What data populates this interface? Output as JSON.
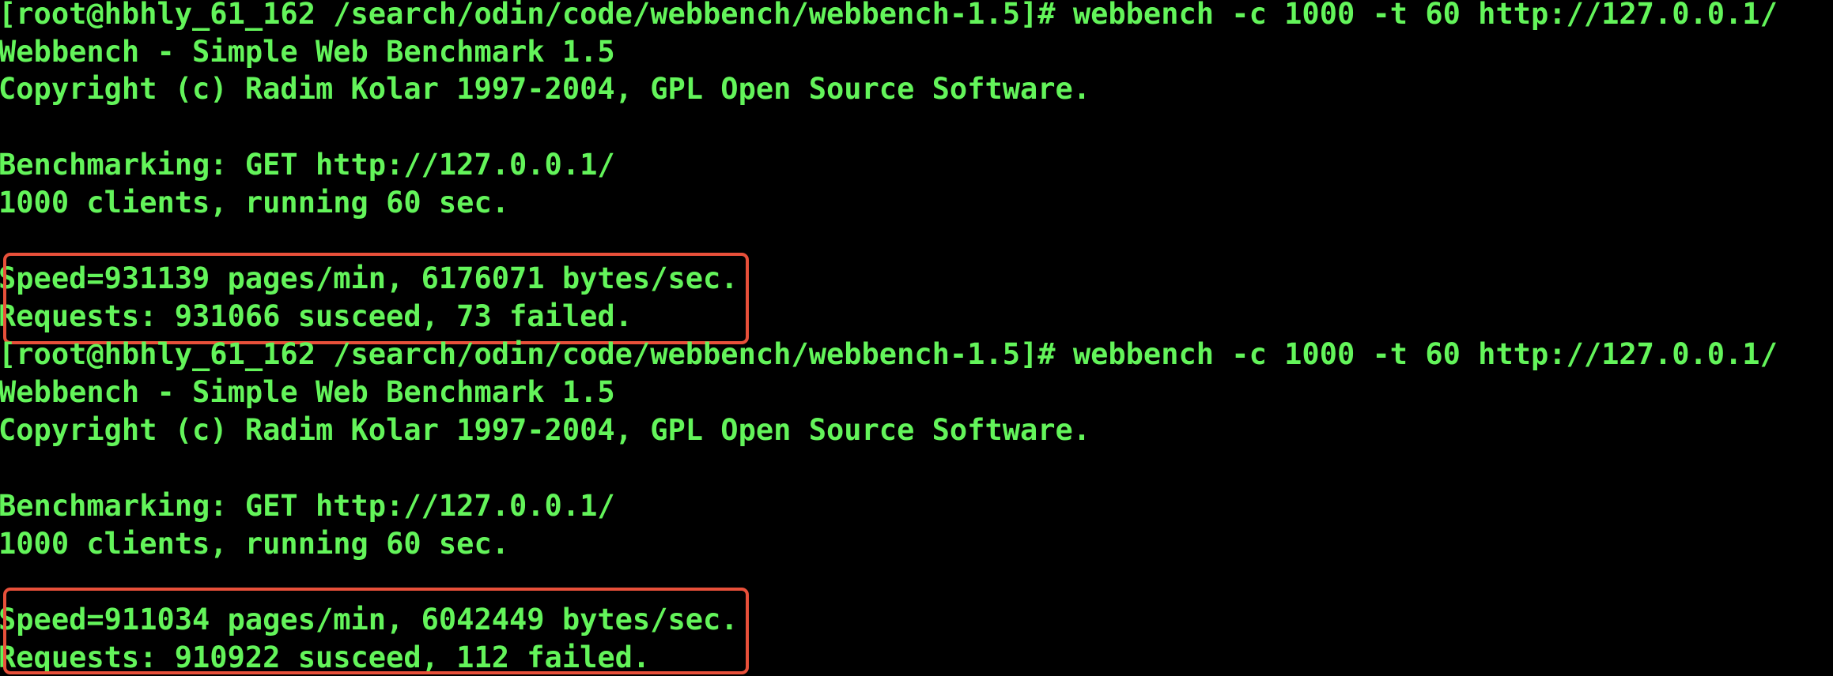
{
  "terminal": {
    "text_color": "#63f45a",
    "background_color": "#000000",
    "highlight_color": "#e8503a",
    "runs": [
      {
        "prompt": "[root@hbhly_61_162 /search/odin/code/webbench/webbench-1.5]# webbench -c 1000 -t 60 http://127.0.0.1/",
        "banner": "Webbench - Simple Web Benchmark 1.5",
        "copyright": "Copyright (c) Radim Kolar 1997-2004, GPL Open Source Software.",
        "benchmarking": "Benchmarking: GET http://127.0.0.1/",
        "clients": "1000 clients, running 60 sec.",
        "speed": "Speed=931139 pages/min, 6176071 bytes/sec.",
        "requests": "Requests: 931066 susceed, 73 failed."
      },
      {
        "prompt": "[root@hbhly_61_162 /search/odin/code/webbench/webbench-1.5]# webbench -c 1000 -t 60 http://127.0.0.1/",
        "banner": "Webbench - Simple Web Benchmark 1.5",
        "copyright": "Copyright (c) Radim Kolar 1997-2004, GPL Open Source Software.",
        "benchmarking": "Benchmarking: GET http://127.0.0.1/",
        "clients": "1000 clients, running 60 sec.",
        "speed": "Speed=911034 pages/min, 6042449 bytes/sec.",
        "requests": "Requests: 910922 susceed, 112 failed."
      }
    ]
  }
}
